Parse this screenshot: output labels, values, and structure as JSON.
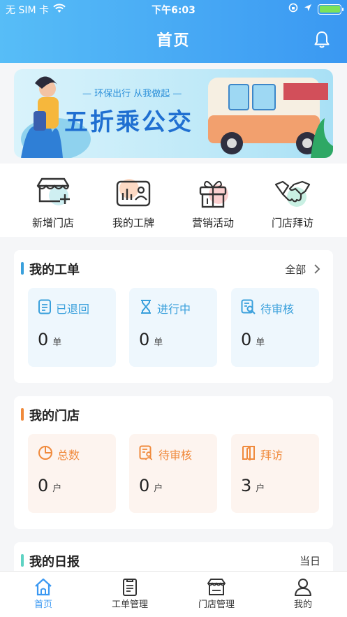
{
  "status_bar": {
    "carrier": "无 SIM 卡",
    "time": "下午6:03",
    "battery_level": 1.0
  },
  "header": {
    "title": "首页",
    "icon": "bell-icon"
  },
  "banner": {
    "slogan": "— 环保出行 从我做起 —",
    "headline": "五折乘公交"
  },
  "quick_actions": [
    {
      "label": "新增门店",
      "icon": "add-store-icon"
    },
    {
      "label": "我的工牌",
      "icon": "badge-icon"
    },
    {
      "label": "营销活动",
      "icon": "gift-icon"
    },
    {
      "label": "门店拜访",
      "icon": "handshake-icon"
    }
  ],
  "work_orders": {
    "title": "我的工单",
    "more_label": "全部",
    "accent": "#3aa0dc",
    "tiles": [
      {
        "label": "已退回",
        "value": "0",
        "unit": "单",
        "icon": "document-icon"
      },
      {
        "label": "进行中",
        "value": "0",
        "unit": "单",
        "icon": "hourglass-icon"
      },
      {
        "label": "待审核",
        "value": "0",
        "unit": "单",
        "icon": "review-search-icon"
      }
    ]
  },
  "stores": {
    "title": "我的门店",
    "accent": "#f08a3c",
    "tiles": [
      {
        "label": "总数",
        "value": "0",
        "unit": "户",
        "icon": "pie-chart-icon"
      },
      {
        "label": "待审核",
        "value": "0",
        "unit": "户",
        "icon": "review-person-icon"
      },
      {
        "label": "拜访",
        "value": "3",
        "unit": "户",
        "icon": "door-icon"
      }
    ]
  },
  "daily": {
    "title": "我的日报",
    "filter": "当日",
    "accent": "#5fd3c3"
  },
  "tabbar": [
    {
      "label": "首页",
      "icon": "home-icon",
      "active": true
    },
    {
      "label": "工单管理",
      "icon": "clipboard-icon",
      "active": false
    },
    {
      "label": "门店管理",
      "icon": "store-icon",
      "active": false
    },
    {
      "label": "我的",
      "icon": "user-icon",
      "active": false
    }
  ]
}
